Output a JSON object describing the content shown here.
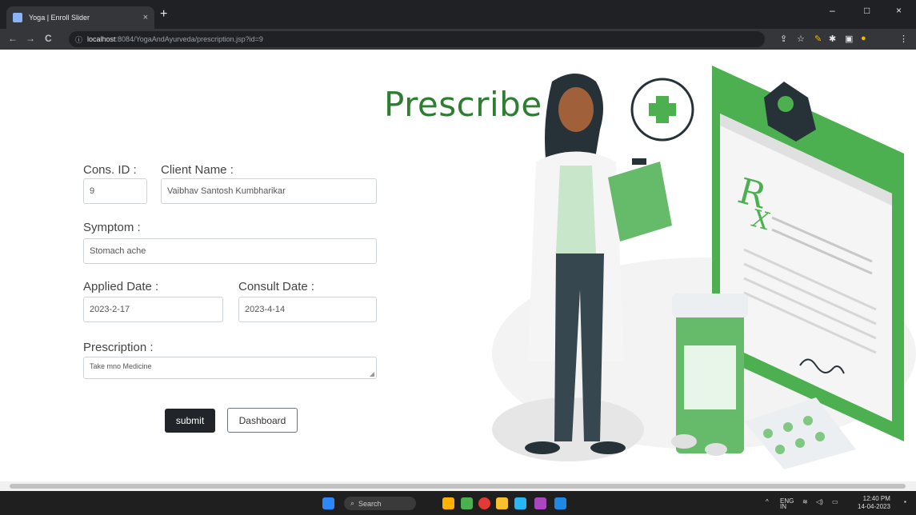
{
  "browser": {
    "tab_title": "Yoga | Enroll Slider",
    "tab_close": "×",
    "new_tab": "+",
    "url_host": "localhost",
    "url_path": ":8084/YogaAndAyurveda/prescription.jsp?id=9",
    "info_glyph": "ⓘ",
    "back": "←",
    "forward": "→",
    "reload": "C",
    "minimize": "–",
    "maximize": "□",
    "close": "×"
  },
  "page": {
    "heading": "Prescribe",
    "form": {
      "cons_id_label": "Cons. ID :",
      "cons_id_value": "9",
      "client_name_label": "Client Name :",
      "client_name_value": "Vaibhav Santosh Kumbharikar",
      "symptom_label": "Symptom :",
      "symptom_value": "Stomach ache",
      "applied_date_label": "Applied Date :",
      "applied_date_value": "2023-2-17",
      "consult_date_label": "Consult Date :",
      "consult_date_value": "2023-4-14",
      "prescription_label": "Prescription :",
      "prescription_value": "Take mno Medicine",
      "submit_label": "submit",
      "dashboard_label": "Dashboard"
    }
  },
  "taskbar": {
    "search_label": "Search",
    "lang": "ENG",
    "region": "IN",
    "time": "12:40 PM",
    "date": "14-04-2023"
  },
  "colors": {
    "accent_green": "#4caf50",
    "heading_green": "#2e7d32",
    "button_dark": "#212529"
  }
}
